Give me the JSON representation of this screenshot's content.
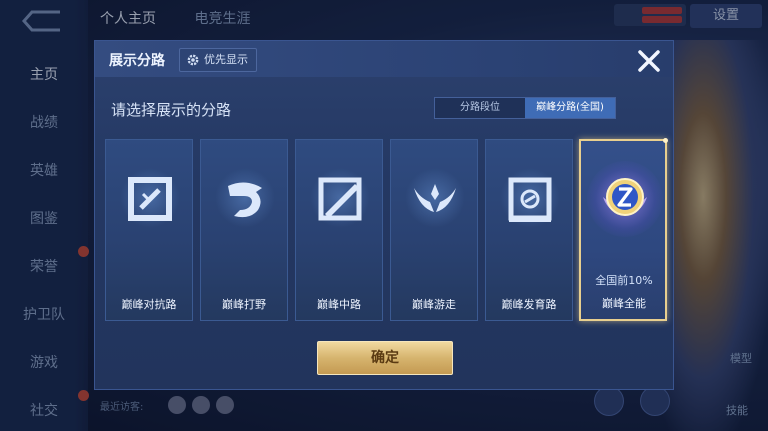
{
  "background": {
    "nav": [
      {
        "label": "主页",
        "active": true
      },
      {
        "label": "战绩"
      },
      {
        "label": "英雄"
      },
      {
        "label": "图鉴"
      },
      {
        "label": "荣誉"
      },
      {
        "label": "护卫队"
      },
      {
        "label": "游戏"
      },
      {
        "label": "社交"
      }
    ],
    "top_tabs": [
      "个人主页",
      "电竞生涯"
    ],
    "top_right_button": "设置",
    "bottom_text": "最近访客:",
    "right_labels": [
      "模型",
      "技能"
    ]
  },
  "modal": {
    "title": "展示分路",
    "priority_button": "优先显示",
    "subtitle": "请选择展示的分路",
    "toggle": {
      "options": [
        "分路段位",
        "巅峰分路(全国)"
      ],
      "selected": "巅峰分路(全国)"
    },
    "cards": [
      {
        "label": "巅峰对抗路",
        "icon": "sword-icon",
        "selected": false
      },
      {
        "label": "巅峰打野",
        "icon": "dragon-icon",
        "selected": false
      },
      {
        "label": "巅峰中路",
        "icon": "blade-icon",
        "selected": false
      },
      {
        "label": "巅峰游走",
        "icon": "wings-icon",
        "selected": false
      },
      {
        "label": "巅峰发育路",
        "icon": "target-icon",
        "selected": false
      },
      {
        "label": "巅峰全能",
        "icon": "all-round-emblem-icon",
        "selected": true,
        "rank": "全国前10%"
      }
    ],
    "confirm_button": "确定"
  },
  "colors": {
    "accent_gold": "#e8cf8f",
    "toggle_selected": "#3f6cb6",
    "panel": "#243863"
  }
}
